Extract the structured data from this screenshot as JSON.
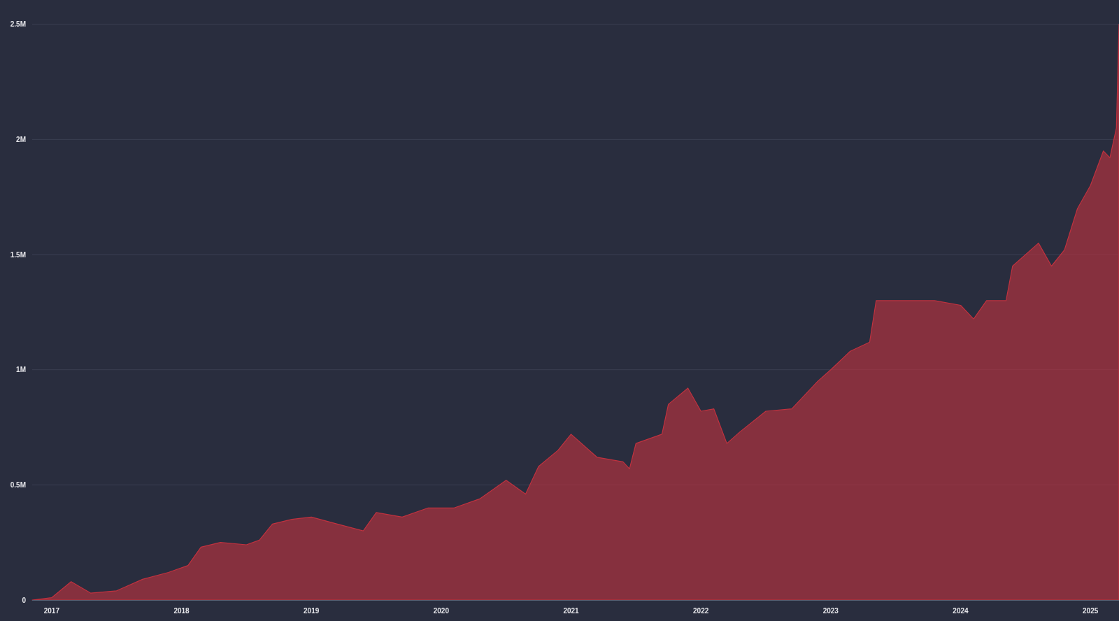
{
  "chart_data": {
    "type": "area",
    "x": [
      2016.85,
      2017.0,
      2017.15,
      2017.3,
      2017.5,
      2017.7,
      2017.9,
      2018.05,
      2018.15,
      2018.3,
      2018.5,
      2018.6,
      2018.7,
      2018.85,
      2019.0,
      2019.2,
      2019.4,
      2019.5,
      2019.7,
      2019.9,
      2020.1,
      2020.3,
      2020.5,
      2020.65,
      2020.75,
      2020.9,
      2021.0,
      2021.2,
      2021.4,
      2021.45,
      2021.5,
      2021.7,
      2021.75,
      2021.9,
      2022.0,
      2022.1,
      2022.2,
      2022.3,
      2022.5,
      2022.7,
      2022.9,
      2023.0,
      2023.15,
      2023.3,
      2023.35,
      2023.5,
      2023.8,
      2024.0,
      2024.1,
      2024.2,
      2024.35,
      2024.4,
      2024.6,
      2024.7,
      2024.8,
      2024.9,
      2025.0,
      2025.1,
      2025.15,
      2025.2,
      2025.22
    ],
    "series": [
      {
        "color": "#c0323f",
        "values": [
          0,
          10000,
          80000,
          30000,
          40000,
          90000,
          120000,
          150000,
          230000,
          250000,
          240000,
          260000,
          330000,
          350000,
          360000,
          330000,
          300000,
          380000,
          360000,
          400000,
          400000,
          440000,
          520000,
          460000,
          580000,
          650000,
          720000,
          620000,
          600000,
          570000,
          680000,
          720000,
          850000,
          920000,
          820000,
          830000,
          680000,
          730000,
          820000,
          830000,
          950000,
          1000000,
          1080000,
          1120000,
          1300000,
          1300000,
          1300000,
          1280000,
          1220000,
          1300000,
          1300000,
          1450000,
          1550000,
          1450000,
          1520000,
          1700000,
          1800000,
          1950000,
          1920000,
          2050000,
          2500000
        ]
      }
    ],
    "grid": true,
    "xlim": [
      2016.85,
      2025.22
    ],
    "ylim": [
      0,
      2500000
    ],
    "xticks": [
      2017,
      2018,
      2019,
      2020,
      2021,
      2022,
      2023,
      2024,
      2025
    ],
    "yticks": [
      {
        "value": 0,
        "label": "0"
      },
      {
        "value": 500000,
        "label": "0.5M"
      },
      {
        "value": 1000000,
        "label": "1M"
      },
      {
        "value": 1500000,
        "label": "1.5M"
      },
      {
        "value": 2000000,
        "label": "2M"
      },
      {
        "value": 2500000,
        "label": "2.5M"
      }
    ]
  }
}
